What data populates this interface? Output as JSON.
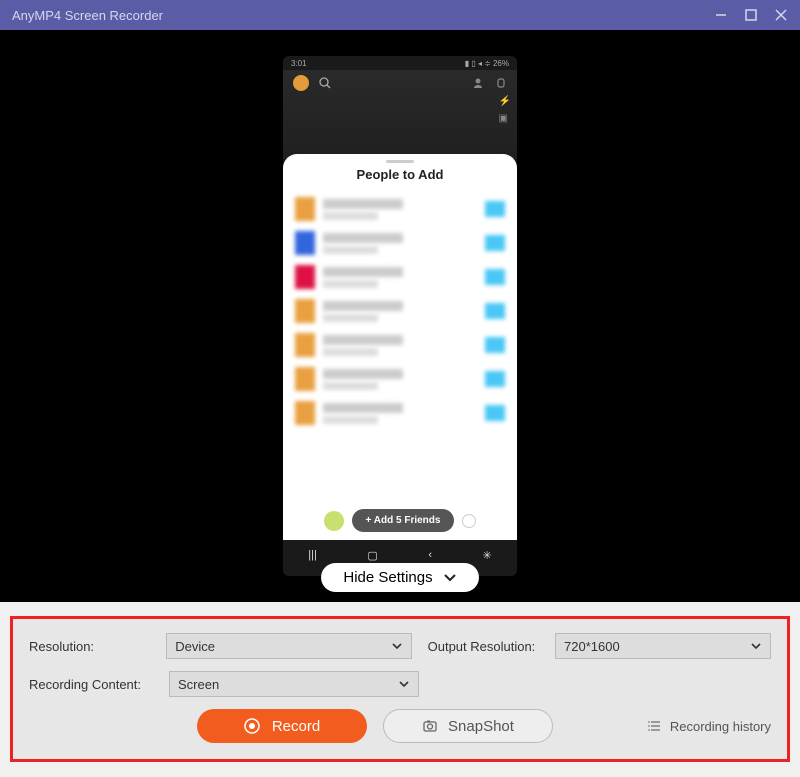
{
  "titlebar": {
    "text": "AnyMP4 Screen Recorder"
  },
  "phone": {
    "status": {
      "time": "3:01",
      "battery": "26%"
    },
    "sheet": {
      "title": "People to Add",
      "add_button": "+ Add 5 Friends"
    }
  },
  "hide_settings": {
    "label": "Hide Settings"
  },
  "settings": {
    "resolution_label": "Resolution:",
    "resolution_value": "Device",
    "output_label": "Output Resolution:",
    "output_value": "720*1600",
    "content_label": "Recording Content:",
    "content_value": "Screen",
    "record_label": "Record",
    "snapshot_label": "SnapShot",
    "history_label": "Recording history"
  }
}
